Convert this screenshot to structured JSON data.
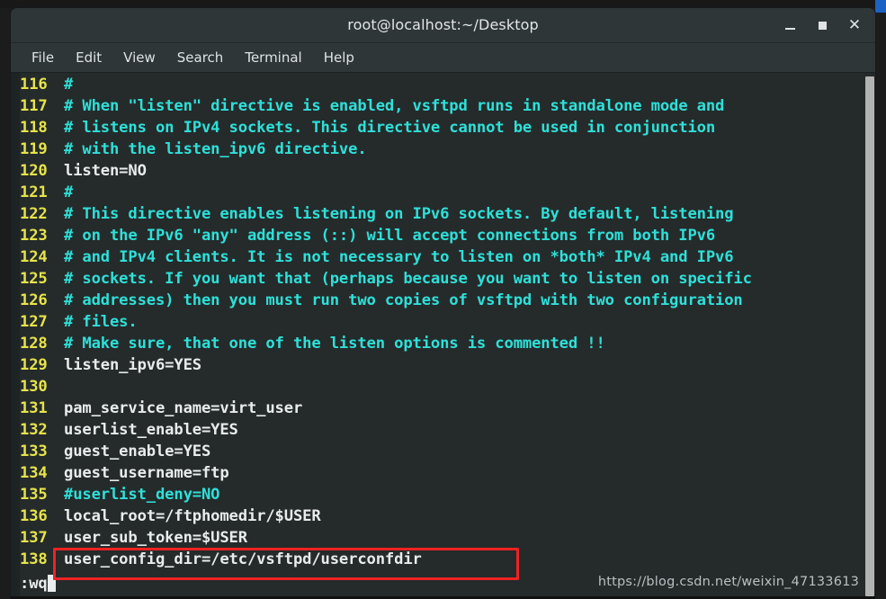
{
  "window": {
    "title": "root@localhost:~/Desktop",
    "controls": {
      "minimize": "minimize",
      "maximize": "maximize",
      "close": "close"
    }
  },
  "menubar": {
    "items": [
      {
        "label": "File"
      },
      {
        "label": "Edit"
      },
      {
        "label": "View"
      },
      {
        "label": "Search"
      },
      {
        "label": "Terminal"
      },
      {
        "label": "Help"
      }
    ]
  },
  "editor": {
    "lines": [
      {
        "number": "116",
        "text": "#",
        "kind": "comment"
      },
      {
        "number": "117",
        "text": "# When \"listen\" directive is enabled, vsftpd runs in standalone mode and",
        "kind": "comment"
      },
      {
        "number": "118",
        "text": "# listens on IPv4 sockets. This directive cannot be used in conjunction",
        "kind": "comment"
      },
      {
        "number": "119",
        "text": "# with the listen_ipv6 directive.",
        "kind": "comment"
      },
      {
        "number": "120",
        "text": "listen=NO",
        "kind": "code"
      },
      {
        "number": "121",
        "text": "#",
        "kind": "comment"
      },
      {
        "number": "122",
        "text": "# This directive enables listening on IPv6 sockets. By default, listening",
        "kind": "comment"
      },
      {
        "number": "123",
        "text": "# on the IPv6 \"any\" address (::) will accept connections from both IPv6",
        "kind": "comment"
      },
      {
        "number": "124",
        "text": "# and IPv4 clients. It is not necessary to listen on *both* IPv4 and IPv6",
        "kind": "comment"
      },
      {
        "number": "125",
        "text": "# sockets. If you want that (perhaps because you want to listen on specific",
        "kind": "comment"
      },
      {
        "number": "126",
        "text": "# addresses) then you must run two copies of vsftpd with two configuration",
        "kind": "comment"
      },
      {
        "number": "127",
        "text": "# files.",
        "kind": "comment"
      },
      {
        "number": "128",
        "text": "# Make sure, that one of the listen options is commented !!",
        "kind": "comment"
      },
      {
        "number": "129",
        "text": "listen_ipv6=YES",
        "kind": "code"
      },
      {
        "number": "130",
        "text": "",
        "kind": "code"
      },
      {
        "number": "131",
        "text": "pam_service_name=virt_user",
        "kind": "code"
      },
      {
        "number": "132",
        "text": "userlist_enable=YES",
        "kind": "code"
      },
      {
        "number": "133",
        "text": "guest_enable=YES",
        "kind": "code"
      },
      {
        "number": "134",
        "text": "guest_username=ftp",
        "kind": "code"
      },
      {
        "number": "135",
        "text": "#userlist_deny=NO",
        "kind": "comment"
      },
      {
        "number": "136",
        "text": "local_root=/ftphomedir/$USER",
        "kind": "code"
      },
      {
        "number": "137",
        "text": "user_sub_token=$USER",
        "kind": "code"
      },
      {
        "number": "138",
        "text": "user_config_dir=/etc/vsftpd/userconfdir",
        "kind": "code"
      }
    ],
    "command_line": ":wq",
    "highlighted_line_number": "138"
  },
  "watermark": {
    "text": "https://blog.csdn.net/weixin_47133613"
  },
  "colors": {
    "line_number": "#e6e44a",
    "comment": "#2ee0d8",
    "code": "#e8ecec",
    "terminal_background": "#252a2b",
    "annotation": "#ef2222"
  }
}
